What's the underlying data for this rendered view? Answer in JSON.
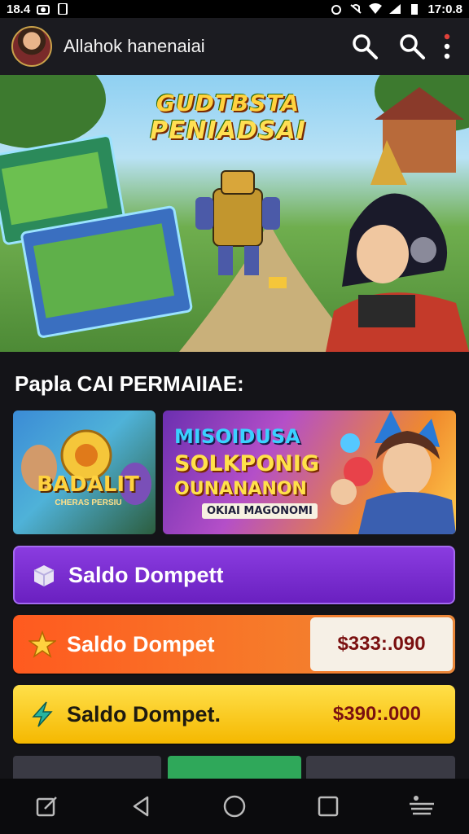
{
  "status_bar": {
    "time": "18.4",
    "clock": "17:0.8"
  },
  "header": {
    "title": "Allahok hanenaiai"
  },
  "hero": {
    "title_line1": "GUDTBSTA",
    "title_line2": "PENIADSAI"
  },
  "section": {
    "title": "Papla CAI PERMAIIAE:"
  },
  "promos": [
    {
      "title": "BADALIT",
      "subtitle": "CHERAS PERSIU"
    },
    {
      "line1": "MISOIDUSA",
      "line2": "SOLKPONIG",
      "line3": "OUNANANON",
      "line4": "OKIAI MAGONOMI"
    }
  ],
  "wallets": [
    {
      "label": "Saldo Dompett",
      "amount": ""
    },
    {
      "label": "Saldo Dompet",
      "amount": "$333:.090"
    },
    {
      "label": "Saldo Dompet.",
      "amount": "$390:.000"
    }
  ],
  "colors": {
    "purple": "#7a30d6",
    "orange": "#ff5a1f",
    "yellow": "#ffd000",
    "accent_gold": "#c9a24a"
  },
  "icons": [
    "search-icon",
    "search-icon",
    "more-vert-icon",
    "cube-icon",
    "star-icon",
    "bolt-icon",
    "back-icon",
    "home-icon",
    "recents-icon"
  ]
}
